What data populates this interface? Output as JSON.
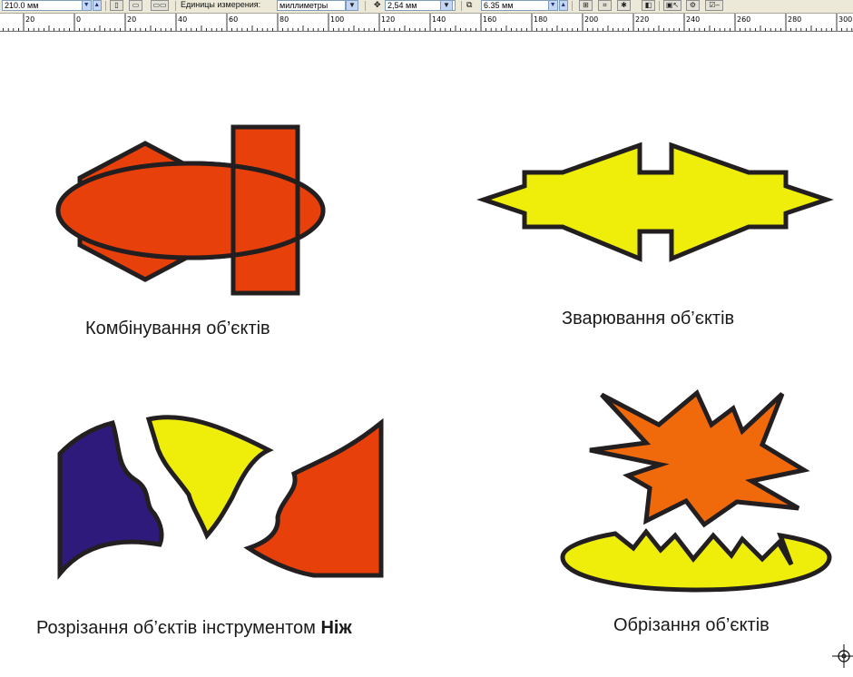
{
  "property_bar": {
    "page_width": "210.0 мм",
    "units_label": "Единицы измерения:",
    "units_value": "миллиметры",
    "nudge_value": "2,54 мм",
    "duplicate_value": "6.35 мм"
  },
  "ruler": {
    "labels": [
      "20",
      "0",
      "20",
      "40",
      "60",
      "80",
      "100",
      "120",
      "140",
      "160",
      "180",
      "200",
      "220",
      "240",
      "260",
      "280",
      "300"
    ]
  },
  "captions": {
    "combine": "Комбінування об’єктів",
    "weld": "Зварювання об’єктів",
    "cut_prefix": "Розрізання об’єктів інструментом ",
    "cut_tool": "Ніж",
    "trim": "Обрізання об’єктів"
  },
  "colors": {
    "orange_red": "#e8400a",
    "orange": "#f06a0c",
    "yellow": "#eeee0a",
    "purple": "#2e1a7a",
    "outline": "#231f20"
  }
}
